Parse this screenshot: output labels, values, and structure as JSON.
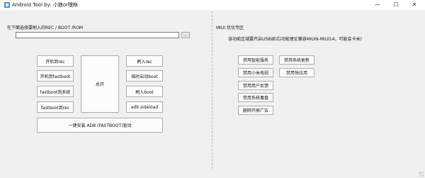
{
  "window": {
    "title": "Android Tool by: 小狼or嘿咻",
    "minimize": "—",
    "maximize": "☐",
    "close": "✕"
  },
  "left": {
    "instruction": "在下面选择要刷入的REC / BOOT /ROM",
    "path_value": "",
    "browse_label": "...",
    "buttons": {
      "boot_rec": "开机到rec",
      "boot_fastboot": "开机到fastboot",
      "fastboot_system": "fastboot到系统",
      "fastboot_rec": "fastboot到rec",
      "unlock": "总开",
      "flash_rec": "刷入rec",
      "temp_boot": "临时启动boot",
      "flash_boot": "刷入boot",
      "adb_sideload": "adb sideload",
      "install_driver": "一键安装 ADB (FASTBOOT)驱动"
    }
  },
  "right": {
    "section_title": "MIUI 优化专区",
    "note": "该功能区域要开启USB调试(功能理论兼容MIUI9-MIUI14，可能会卡米)",
    "buttons": {
      "disable_smart_service": "禁用智能服务",
      "disable_system_update": "禁用系统更新",
      "disable_xiaomi_video": "禁用小米电视",
      "disable_shop": "禁用快应用",
      "disable_user_feedback": "禁用用户反馈",
      "disable_system_security": "禁用系统毒盘",
      "remove_boot_ads": "删除开屏广告"
    }
  }
}
